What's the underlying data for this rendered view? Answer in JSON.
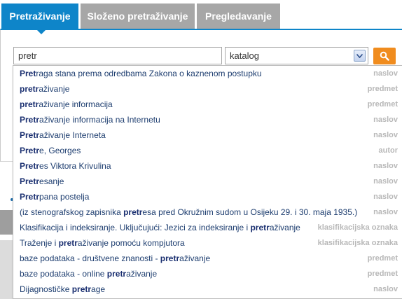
{
  "tabs": [
    "Pretraživanje",
    "Složeno pretraživanje",
    "Pregledavanje"
  ],
  "search": {
    "value": "pretr"
  },
  "select": {
    "value": "katalog"
  },
  "colors": {
    "accent": "#0e85c9",
    "tab_inactive": "#a7a7a7",
    "search_button": "#f08c1e",
    "suggestion_text": "#1d3d6f",
    "type_text": "#b8b8b8"
  },
  "icons": {
    "select_arrow": "chevron-down-icon",
    "search_button": "magnifier-icon"
  },
  "suggestions": [
    {
      "pre": "",
      "match": "Pret",
      "post": "raga stana prema odredbama Zakona o kaznenom postupku",
      "type": "naslov"
    },
    {
      "pre": "",
      "match": "pretr",
      "post": "aživanje",
      "type": "predmet"
    },
    {
      "pre": "",
      "match": "pretr",
      "post": "aživanje informacija",
      "type": "predmet"
    },
    {
      "pre": "",
      "match": "Pretr",
      "post": "aživanje informacija na Internetu",
      "type": "naslov"
    },
    {
      "pre": "",
      "match": "Pretr",
      "post": "aživanje Interneta",
      "type": "naslov"
    },
    {
      "pre": "",
      "match": "Pretr",
      "post": "e, Georges",
      "type": "autor"
    },
    {
      "pre": "",
      "match": "Pretr",
      "post": "es Viktora Krivulina",
      "type": "naslov"
    },
    {
      "pre": "",
      "match": "Pretr",
      "post": "esanje",
      "type": "naslov"
    },
    {
      "pre": "",
      "match": "Pretr",
      "post": "pana postelja",
      "type": "naslov"
    },
    {
      "pre": "(iz stenografskog zapisnika ",
      "match": "pretr",
      "post": "esa pred Okružnim sudom u Osijeku 29. i 30. maja 1935.)",
      "type": "naslov"
    },
    {
      "pre": "Klasifikacija i indeksiranje. Uključujući: Jezici za indeksiranje i ",
      "match": "pretr",
      "post": "aživanje",
      "type": "klasifikacijska oznaka"
    },
    {
      "pre": "Traženje i ",
      "match": "pretr",
      "post": "aživanje pomoću kompjutora",
      "type": "klasifikacijska oznaka"
    },
    {
      "pre": "baze podataka - društvene znanosti - ",
      "match": "pretr",
      "post": "aživanje",
      "type": "predmet"
    },
    {
      "pre": "baze podataka - online ",
      "match": "pretr",
      "post": "aživanje",
      "type": "predmet"
    },
    {
      "pre": "Dijagnostičke ",
      "match": "pretr",
      "post": "age",
      "type": "naslov"
    }
  ]
}
